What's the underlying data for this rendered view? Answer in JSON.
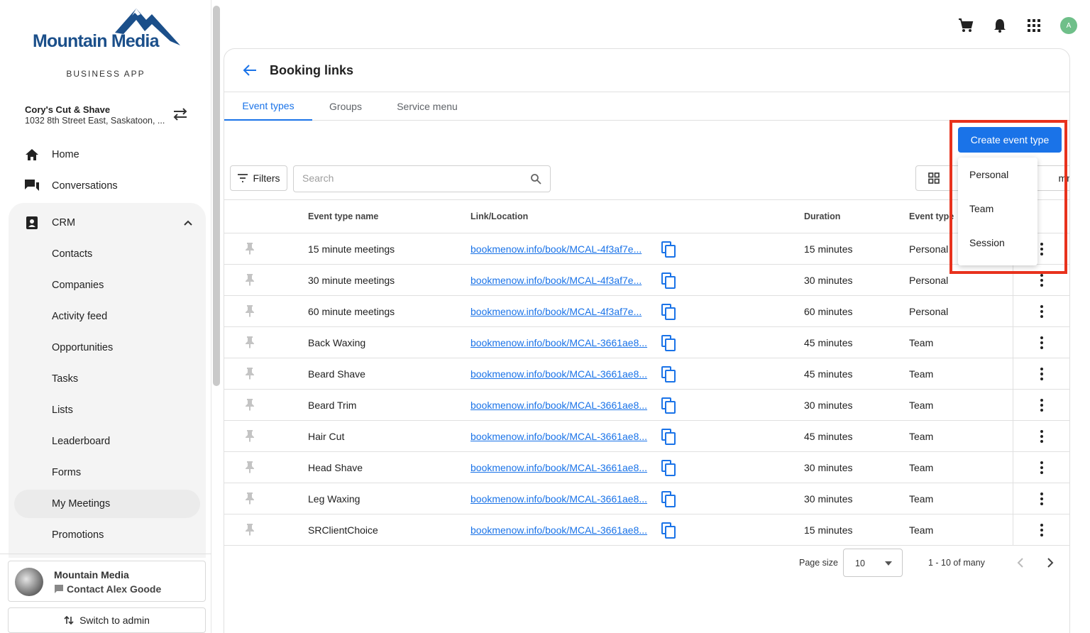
{
  "brand": {
    "logo_text": "Mountain Media",
    "app_label": "BUSINESS APP"
  },
  "business": {
    "name": "Cory's Cut & Shave",
    "address": "1032 8th Street East, Saskatoon, ..."
  },
  "nav": {
    "home": "Home",
    "conversations": "Conversations",
    "crm": "CRM",
    "crm_items": [
      "Contacts",
      "Companies",
      "Activity feed",
      "Opportunities",
      "Tasks",
      "Lists",
      "Leaderboard",
      "Forms",
      "My Meetings",
      "Promotions"
    ],
    "active_item": "My Meetings"
  },
  "account": {
    "name": "Mountain Media",
    "contact": "Contact Alex Goode",
    "switch_admin": "Switch to admin"
  },
  "topbar": {
    "avatar_initial": "A"
  },
  "page": {
    "title": "Booking links",
    "tabs": [
      "Event types",
      "Groups",
      "Service menu"
    ],
    "active_tab": "Event types"
  },
  "toolbar": {
    "filters_label": "Filters",
    "search_placeholder": "Search",
    "columns_label": "mns",
    "create_label": "Create event type"
  },
  "create_menu": {
    "items": [
      "Personal",
      "Team",
      "Session"
    ]
  },
  "table": {
    "headers": {
      "name": "Event type name",
      "link": "Link/Location",
      "duration": "Duration",
      "event_type": "Event type"
    },
    "rows": [
      {
        "name": "15 minute meetings",
        "link": "bookmenow.info/book/MCAL-4f3af7e...",
        "duration": "15 minutes",
        "type": "Personal"
      },
      {
        "name": "30 minute meetings",
        "link": "bookmenow.info/book/MCAL-4f3af7e...",
        "duration": "30 minutes",
        "type": "Personal"
      },
      {
        "name": "60 minute meetings",
        "link": "bookmenow.info/book/MCAL-4f3af7e...",
        "duration": "60 minutes",
        "type": "Personal"
      },
      {
        "name": "Back Waxing",
        "link": "bookmenow.info/book/MCAL-3661ae8...",
        "duration": "45 minutes",
        "type": "Team"
      },
      {
        "name": "Beard Shave",
        "link": "bookmenow.info/book/MCAL-3661ae8...",
        "duration": "45 minutes",
        "type": "Team"
      },
      {
        "name": "Beard Trim",
        "link": "bookmenow.info/book/MCAL-3661ae8...",
        "duration": "30 minutes",
        "type": "Team"
      },
      {
        "name": "Hair Cut",
        "link": "bookmenow.info/book/MCAL-3661ae8...",
        "duration": "45 minutes",
        "type": "Team"
      },
      {
        "name": "Head Shave",
        "link": "bookmenow.info/book/MCAL-3661ae8...",
        "duration": "30 minutes",
        "type": "Team"
      },
      {
        "name": "Leg Waxing",
        "link": "bookmenow.info/book/MCAL-3661ae8...",
        "duration": "30 minutes",
        "type": "Team"
      },
      {
        "name": "SRClientChoice",
        "link": "bookmenow.info/book/MCAL-3661ae8...",
        "duration": "15 minutes",
        "type": "Team"
      }
    ]
  },
  "pagination": {
    "page_size_label": "Page size",
    "page_size": "10",
    "range": "1 - 10 of many"
  },
  "colors": {
    "accent": "#1a73e8",
    "highlight": "#e8321d",
    "brand": "#1b4f8a"
  }
}
